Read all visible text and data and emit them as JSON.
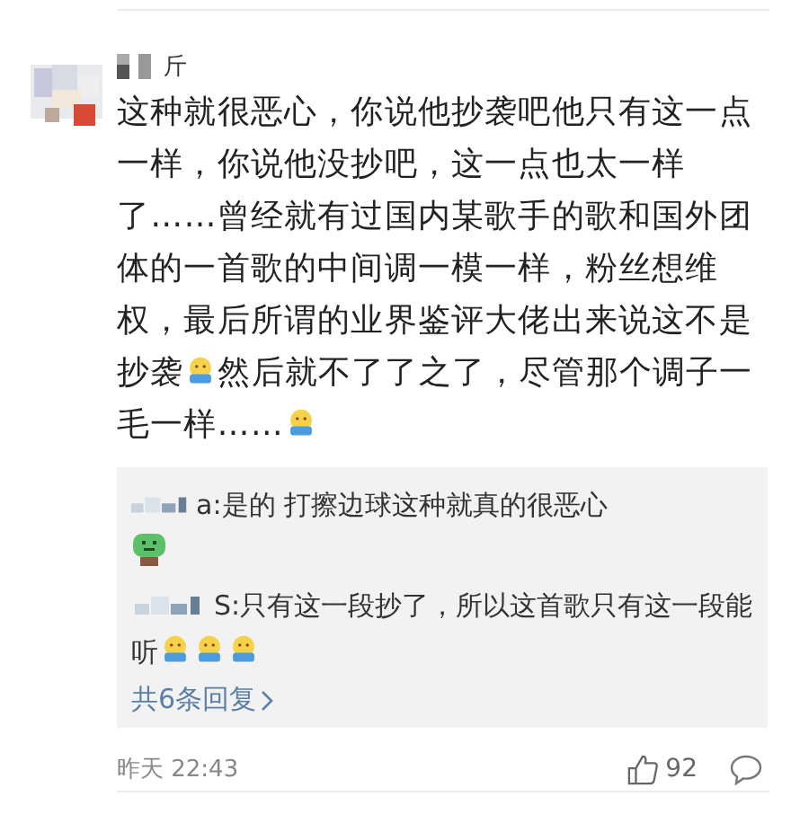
{
  "comment": {
    "author": "斤",
    "body": [
      {
        "kind": "text",
        "text": "这种就很恶心，你说他抄袭吧他只有这一点一样，你说他没抄吧，这一点也太一样了……曾经就有过国内某歌手的歌和国外团体的一首歌的中间调一模一样，粉丝想维权，最后所谓的业界鉴评大佬出来说这不是抄袭"
      },
      {
        "kind": "emoji"
      },
      {
        "kind": "text",
        "text": "然后就不了了之了，尽管那个调子一毛一样……"
      },
      {
        "kind": "emoji"
      }
    ],
    "replies": [
      {
        "author": "a:",
        "segments": [
          {
            "kind": "text",
            "text": "是的 打擦边球这种就真的很恶心"
          },
          {
            "kind": "break"
          },
          {
            "kind": "sick"
          }
        ]
      },
      {
        "author": "S:",
        "segments": [
          {
            "kind": "text",
            "text": "只有这一段抄了，所以这首歌只有这一段能听"
          },
          {
            "kind": "emoji"
          },
          {
            "kind": "emoji"
          },
          {
            "kind": "emoji"
          }
        ]
      }
    ],
    "more_replies": "共6条回复",
    "time": "昨天 22:43",
    "likes": "92"
  }
}
